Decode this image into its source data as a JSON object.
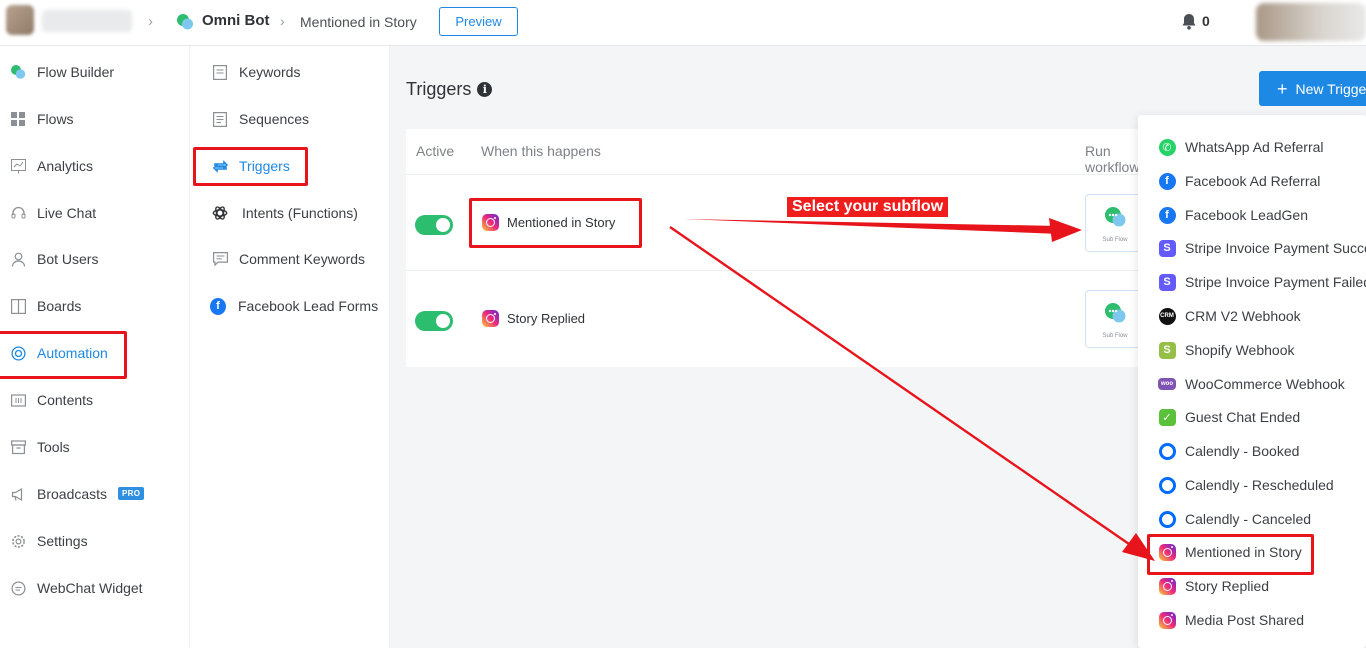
{
  "topbar": {
    "bot_name": "Omni Bot",
    "breadcrumb": "Mentioned in Story",
    "preview_label": "Preview",
    "notification_count": "0"
  },
  "sidebar": {
    "items": [
      {
        "label": "Flow Builder",
        "icon": "chat-bubbles-icon"
      },
      {
        "label": "Flows",
        "icon": "grid-icon"
      },
      {
        "label": "Analytics",
        "icon": "chart-icon"
      },
      {
        "label": "Live Chat",
        "icon": "headset-icon"
      },
      {
        "label": "Bot Users",
        "icon": "user-icon"
      },
      {
        "label": "Boards",
        "icon": "columns-icon"
      },
      {
        "label": "Automation",
        "icon": "automation-icon",
        "active": true
      },
      {
        "label": "Contents",
        "icon": "contents-icon"
      },
      {
        "label": "Tools",
        "icon": "toolbox-icon"
      },
      {
        "label": "Broadcasts",
        "icon": "megaphone-icon",
        "badge": "PRO"
      },
      {
        "label": "Settings",
        "icon": "gear-icon"
      },
      {
        "label": "WebChat Widget",
        "icon": "chat-icon"
      }
    ]
  },
  "subnav": {
    "items": [
      {
        "label": "Keywords",
        "icon": "document-icon"
      },
      {
        "label": "Sequences",
        "icon": "document-icon"
      },
      {
        "label": "Triggers",
        "icon": "repeat-icon",
        "active": true
      },
      {
        "label": "Intents (Functions)",
        "icon": "openai-icon"
      },
      {
        "label": "Comment Keywords",
        "icon": "comment-icon"
      },
      {
        "label": "Facebook Lead Forms",
        "icon": "facebook-icon"
      }
    ]
  },
  "main": {
    "title": "Triggers",
    "new_button_label": "New Trigger",
    "columns": {
      "active": "Active",
      "when": "When this happens",
      "run": "Run workflow"
    },
    "rows": [
      {
        "label": "Mentioned in Story",
        "subflow_label": "Sub Flow",
        "active": true
      },
      {
        "label": "Story Replied",
        "subflow_label": "Sub Flow",
        "active": true
      }
    ]
  },
  "annotation": {
    "label": "Select your subflow"
  },
  "dropdown": {
    "items": [
      {
        "label": "WhatsApp Ad Referral",
        "icon": "whatsapp-icon"
      },
      {
        "label": "Facebook Ad Referral",
        "icon": "facebook-icon"
      },
      {
        "label": "Facebook LeadGen",
        "icon": "facebook-icon"
      },
      {
        "label": "Stripe Invoice Payment Succeeded",
        "icon": "stripe-icon"
      },
      {
        "label": "Stripe Invoice Payment Failed",
        "icon": "stripe-icon"
      },
      {
        "label": "CRM V2 Webhook",
        "icon": "crm-icon"
      },
      {
        "label": "Shopify Webhook",
        "icon": "shopify-icon"
      },
      {
        "label": "WooCommerce Webhook",
        "icon": "woocommerce-icon"
      },
      {
        "label": "Guest Chat Ended",
        "icon": "chat-check-icon"
      },
      {
        "label": "Calendly - Booked",
        "icon": "calendly-icon"
      },
      {
        "label": "Calendly - Rescheduled",
        "icon": "calendly-icon"
      },
      {
        "label": "Calendly - Canceled",
        "icon": "calendly-icon"
      },
      {
        "label": "Mentioned in Story",
        "icon": "instagram-icon"
      },
      {
        "label": "Story Replied",
        "icon": "instagram-icon"
      },
      {
        "label": "Media Post Shared",
        "icon": "instagram-icon"
      }
    ]
  },
  "colors": {
    "accent": "#1e88e5",
    "toggle_on": "#2dbd6e",
    "annotation_red": "#e8141b"
  }
}
